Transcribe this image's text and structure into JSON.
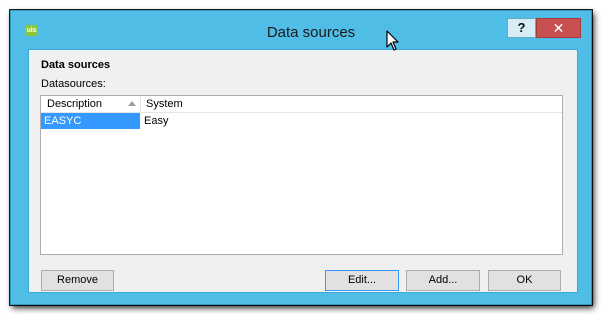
{
  "window": {
    "title": "Data sources",
    "app_icon_text": "uis",
    "help_label": "?",
    "close_label": "✕"
  },
  "panel": {
    "section_title": "Data sources",
    "list_label": "Datasources:"
  },
  "table": {
    "columns": [
      "Description",
      "System"
    ],
    "sorted_column": "Description",
    "sort_direction": "ascending",
    "rows": [
      {
        "description": "EASYC",
        "system": "Easy",
        "selected": true
      }
    ]
  },
  "buttons": {
    "remove": "Remove",
    "edit": "Edit...",
    "add": "Add...",
    "ok": "OK"
  },
  "colors": {
    "titlebar": "#4fbde6",
    "selection": "#3399ff",
    "close_button": "#c75050"
  }
}
